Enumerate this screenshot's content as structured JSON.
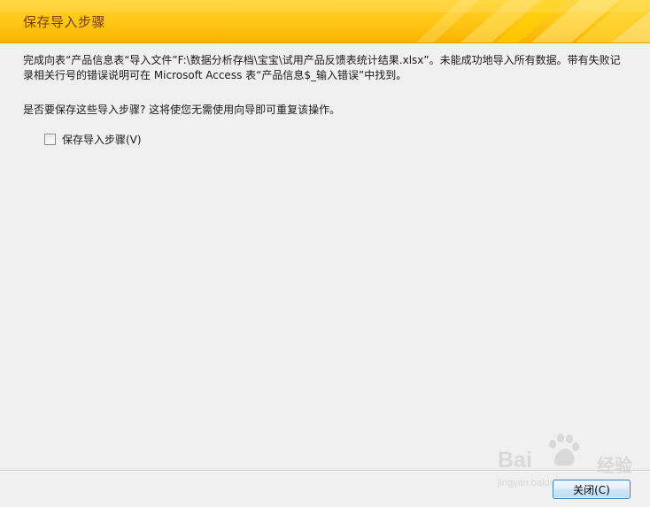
{
  "dialog": {
    "title": "保存导入步骤",
    "message": "完成向表“产品信息表“导入文件”F:\\数据分析存档\\宝宝\\试用产品反馈表统计结果.xlsx”。未能成功地导入所有数据。带有失败记录相关行号的错误说明可在 Microsoft Access 表“产品信息$_输入错误”中找到。",
    "question": "是否要保存这些导入步骤? 这将使您无需使用向导即可重复该操作。",
    "save_steps_checkbox": {
      "label": "保存导入步骤(V)",
      "checked": false
    },
    "close_button_label": "关闭(C)"
  },
  "watermark": {
    "brand": "Bai",
    "brand_tail": "经验",
    "url": "jingyan.baidu.com"
  },
  "colors": {
    "header_yellow": "#ffc514",
    "title_text": "#7a3b00",
    "dialog_bg": "#f0f0f0",
    "button_border": "#3c7fb1"
  }
}
